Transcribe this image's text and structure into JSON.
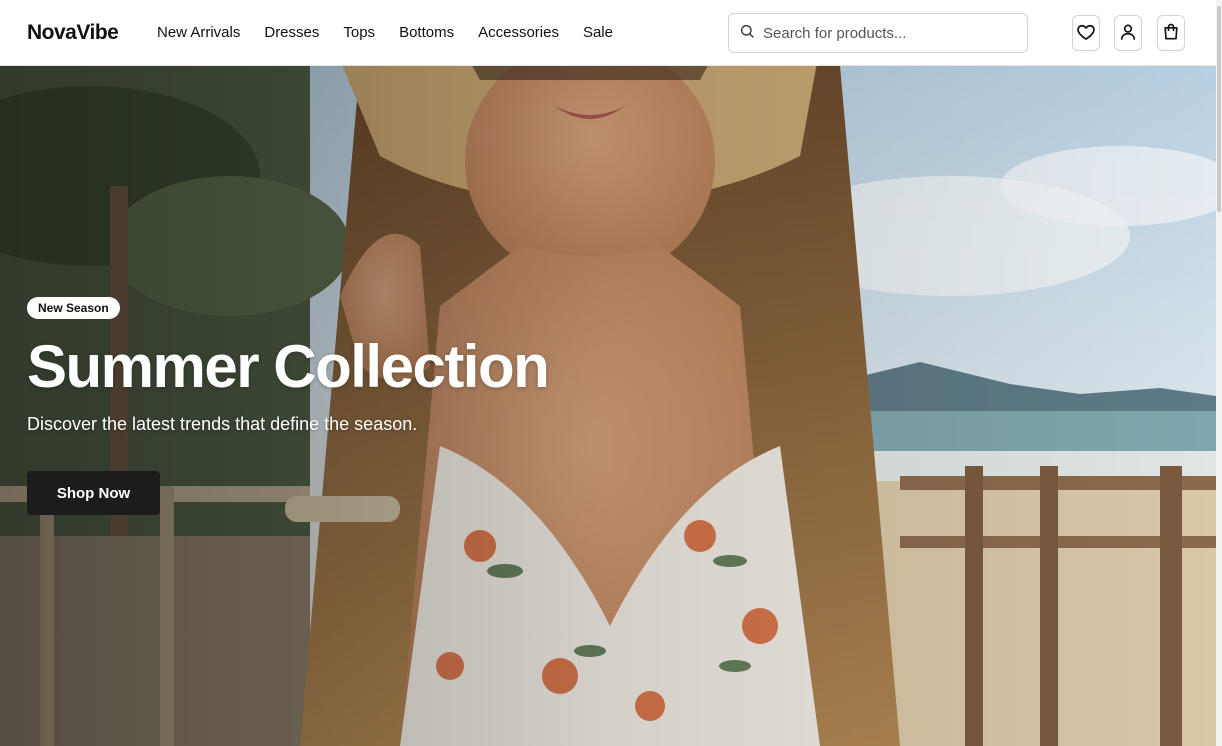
{
  "brand": {
    "name": "NovaVibe"
  },
  "nav": {
    "items": [
      {
        "label": "New Arrivals"
      },
      {
        "label": "Dresses"
      },
      {
        "label": "Tops"
      },
      {
        "label": "Bottoms"
      },
      {
        "label": "Accessories"
      },
      {
        "label": "Sale"
      }
    ]
  },
  "search": {
    "placeholder": "Search for products...",
    "value": "",
    "icon": "search-icon"
  },
  "actions": {
    "icons": [
      "heart-icon",
      "user-icon",
      "shopping-bag-icon"
    ]
  },
  "hero": {
    "badge": "New Season",
    "title": "Summer Collection",
    "subtitle": "Discover the latest trends that define the season.",
    "cta_label": "Shop Now",
    "image": "woman in straw hat and floral sundress on beach boardwalk"
  },
  "colors": {
    "text": "#111111",
    "cta_background": "#1c1c1e",
    "cta_text": "#ffffff",
    "border": "#d4d4d4"
  }
}
